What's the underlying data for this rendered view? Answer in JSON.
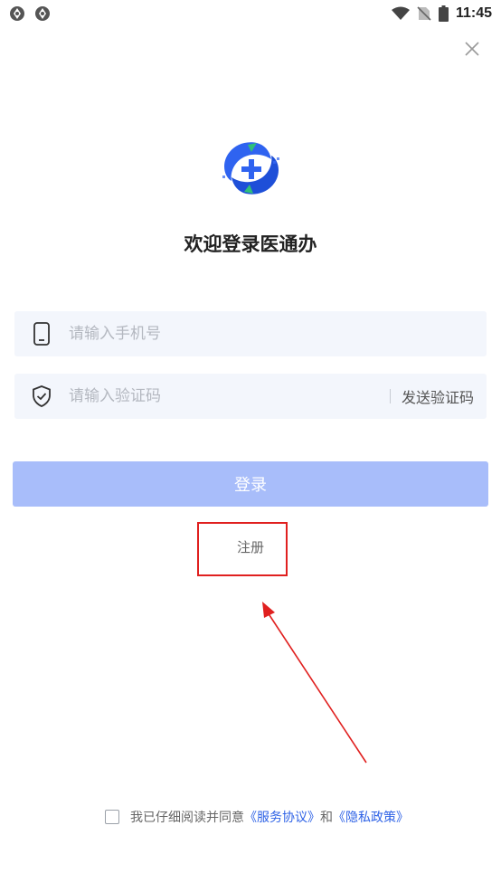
{
  "status_bar": {
    "time": "11:45",
    "left_icons": [
      "app-notification-icon",
      "app-notification-icon"
    ],
    "right_icons": [
      "wifi-icon",
      "no-sim-icon",
      "battery-icon"
    ]
  },
  "header": {
    "close_icon": "close-icon"
  },
  "brand": {
    "title": "欢迎登录医通办",
    "colors": {
      "blue": "#2f63f0",
      "green": "#2ebf7a"
    }
  },
  "form": {
    "phone": {
      "placeholder": "请输入手机号",
      "icon": "phone-icon"
    },
    "code": {
      "placeholder": "请输入验证码",
      "icon": "shield-check-icon",
      "send_label": "发送验证码"
    },
    "login_label": "登录",
    "register_label": "注册"
  },
  "agreement": {
    "prefix": "我已仔细阅读并同意",
    "service_link": "《服务协议》",
    "and": "和",
    "privacy_link": "《隐私政策》",
    "checked": false
  },
  "accent_colors": {
    "button": "#a8bdfa",
    "link": "#2e62e6",
    "annotation": "#e0201f"
  }
}
